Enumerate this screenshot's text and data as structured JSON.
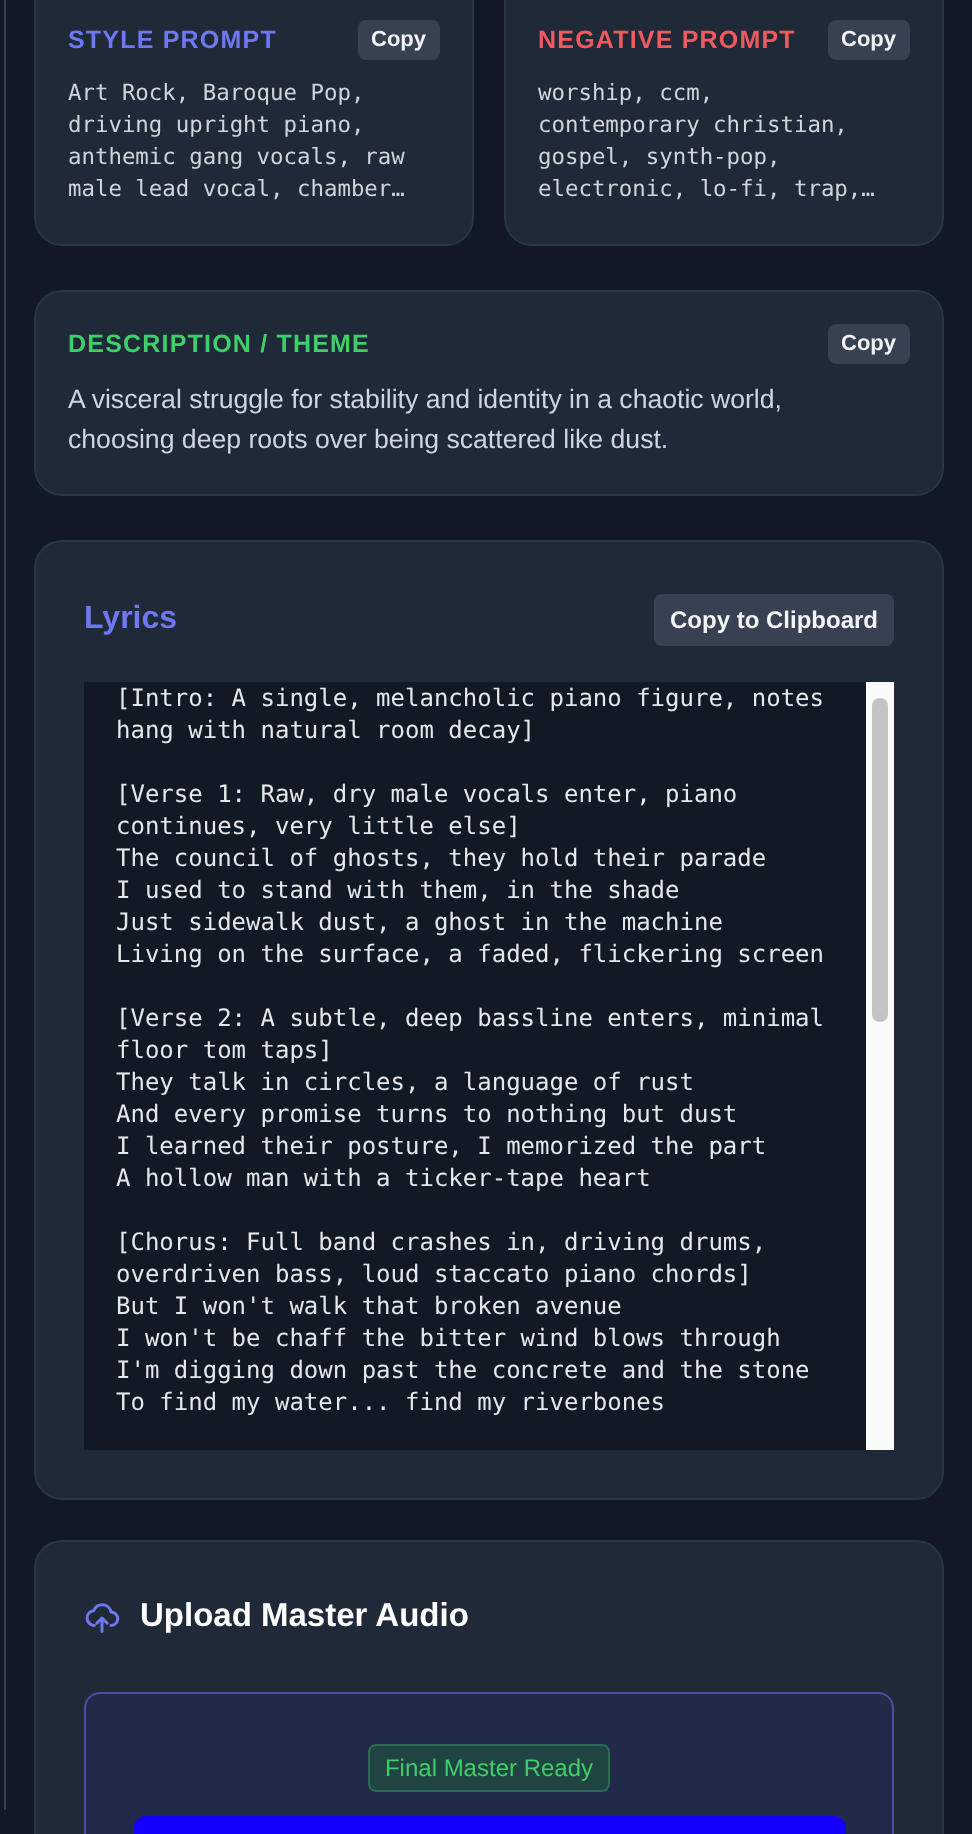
{
  "prompts": [
    {
      "title": "STYLE PROMPT",
      "kind": "style",
      "copy": "Copy",
      "text": "Art Rock, Baroque Pop,\ndriving upright piano,\nanthemic gang vocals, raw\nmale lead vocal, chamber…"
    },
    {
      "title": "NEGATIVE PROMPT",
      "kind": "negative",
      "copy": "Copy",
      "text": "worship, ccm,\ncontemporary christian,\ngospel, synth-pop,\nelectronic, lo-fi, trap,…"
    }
  ],
  "description": {
    "title": "DESCRIPTION / THEME",
    "copy": "Copy",
    "text": "A visceral struggle for stability and identity in a chaotic world, choosing deep roots over being scattered like dust."
  },
  "lyrics": {
    "title": "Lyrics",
    "copy": "Copy to Clipboard",
    "text": "[Intro: A single, melancholic piano figure, notes\nhang with natural room decay]\n\n[Verse 1: Raw, dry male vocals enter, piano\ncontinues, very little else]\nThe council of ghosts, they hold their parade\nI used to stand with them, in the shade\nJust sidewalk dust, a ghost in the machine\nLiving on the surface, a faded, flickering screen\n\n[Verse 2: A subtle, deep bassline enters, minimal\nfloor tom taps]\nThey talk in circles, a language of rust\nAnd every promise turns to nothing but dust\nI learned their posture, I memorized the part\nA hollow man with a ticker-tape heart\n\n[Chorus: Full band crashes in, driving drums,\noverdriven bass, loud staccato piano chords]\nBut I won't walk that broken avenue\nI won't be chaff the bitter wind blows through\nI'm digging down past the concrete and the stone\nTo find my water... find my riverbones"
  },
  "upload": {
    "title": "Upload Master Audio",
    "badge": "Final Master Ready"
  }
}
